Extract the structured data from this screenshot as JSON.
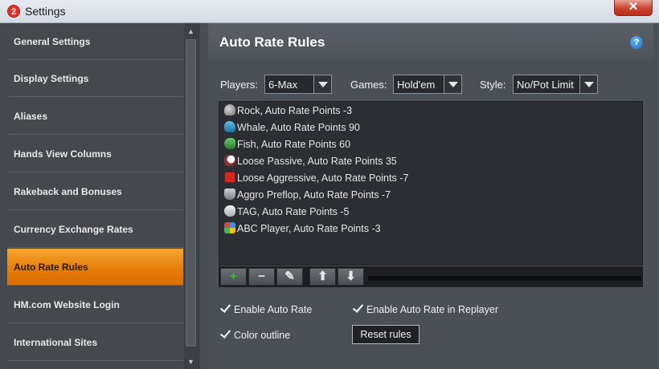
{
  "window": {
    "title": "Settings",
    "app_icon_text": "2",
    "close_label": "✕"
  },
  "sidebar": {
    "items": [
      {
        "label": "General Settings",
        "active": false
      },
      {
        "label": "Display Settings",
        "active": false
      },
      {
        "label": "Aliases",
        "active": false
      },
      {
        "label": "Hands View Columns",
        "active": false
      },
      {
        "label": "Rakeback and Bonuses",
        "active": false
      },
      {
        "label": "Currency Exchange Rates",
        "active": false
      },
      {
        "label": "Auto Rate Rules",
        "active": true
      },
      {
        "label": "HM.com Website Login",
        "active": false
      },
      {
        "label": "International Sites",
        "active": false
      }
    ]
  },
  "panel": {
    "title": "Auto Rate Rules",
    "help_label": "?",
    "filters": {
      "players": {
        "label": "Players:",
        "value": "6-Max"
      },
      "games": {
        "label": "Games:",
        "value": "Hold'em"
      },
      "style": {
        "label": "Style:",
        "value": "No/Pot Limit"
      }
    },
    "rules": [
      {
        "name": "Rock",
        "text": "Rock,  Auto Rate Points  -3",
        "icon": "rock-icon"
      },
      {
        "name": "Whale",
        "text": "Whale,  Auto Rate Points  90",
        "icon": "whale-icon"
      },
      {
        "name": "Fish",
        "text": "Fish,  Auto Rate Points  60",
        "icon": "fish-icon"
      },
      {
        "name": "Loose Passive",
        "text": "Loose Passive,  Auto Rate Points  35",
        "icon": "cow-icon"
      },
      {
        "name": "Loose Aggressive",
        "text": "Loose Aggressive,  Auto Rate Points  -7",
        "icon": "dice-icon"
      },
      {
        "name": "Aggro Preflop",
        "text": "Aggro Preflop,  Auto Rate Points  -7",
        "icon": "tornado-icon"
      },
      {
        "name": "TAG",
        "text": "TAG,  Auto Rate Points  -5",
        "icon": "shark-icon"
      },
      {
        "name": "ABC Player",
        "text": "ABC Player,  Auto Rate Points  -3",
        "icon": "blocks-icon"
      }
    ],
    "toolbar": {
      "add": "+",
      "remove": "−",
      "edit": "✎",
      "up": "⬆",
      "down": "⬇"
    },
    "options": {
      "enable_auto_rate": {
        "label": "Enable Auto Rate",
        "checked": true
      },
      "enable_replayer": {
        "label": "Enable Auto Rate in Replayer",
        "checked": true
      },
      "color_outline": {
        "label": "Color outline",
        "checked": true
      }
    },
    "reset_label": "Reset rules"
  },
  "colors": {
    "accent": "#e67b06",
    "background": "#4b5056",
    "list_bg": "#2b2e32"
  }
}
